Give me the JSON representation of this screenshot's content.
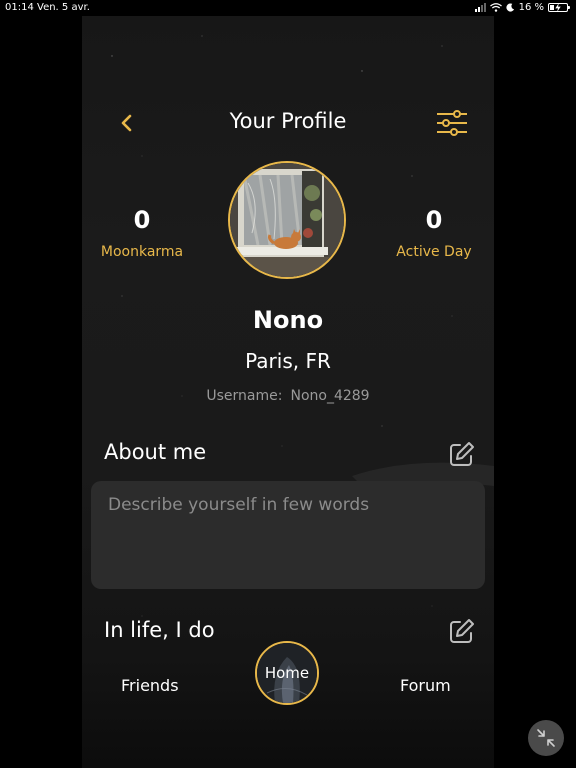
{
  "status_bar": {
    "time": "01:14",
    "date": "Ven. 5 avr.",
    "battery": "16 %"
  },
  "header": {
    "title": "Your Profile",
    "back_icon": "chevron-left-icon",
    "settings_icon": "sliders-icon"
  },
  "stats": {
    "moonkarma_value": "0",
    "moonkarma_label": "Moonkarma",
    "active_day_value": "0",
    "active_day_label": "Active Day"
  },
  "profile": {
    "name": "Nono",
    "location": "Paris, FR",
    "username_label": "Username:",
    "username_value": "Nono_4289"
  },
  "about": {
    "title": "About me",
    "placeholder": "Describe yourself in few words"
  },
  "in_life": {
    "title": "In life, I do"
  },
  "bottom_nav": {
    "friends": "Friends",
    "home": "Home",
    "forum": "Forum"
  },
  "colors": {
    "accent": "#e8b84a",
    "background": "#1a1a1a",
    "card": "#2c2c2c"
  }
}
